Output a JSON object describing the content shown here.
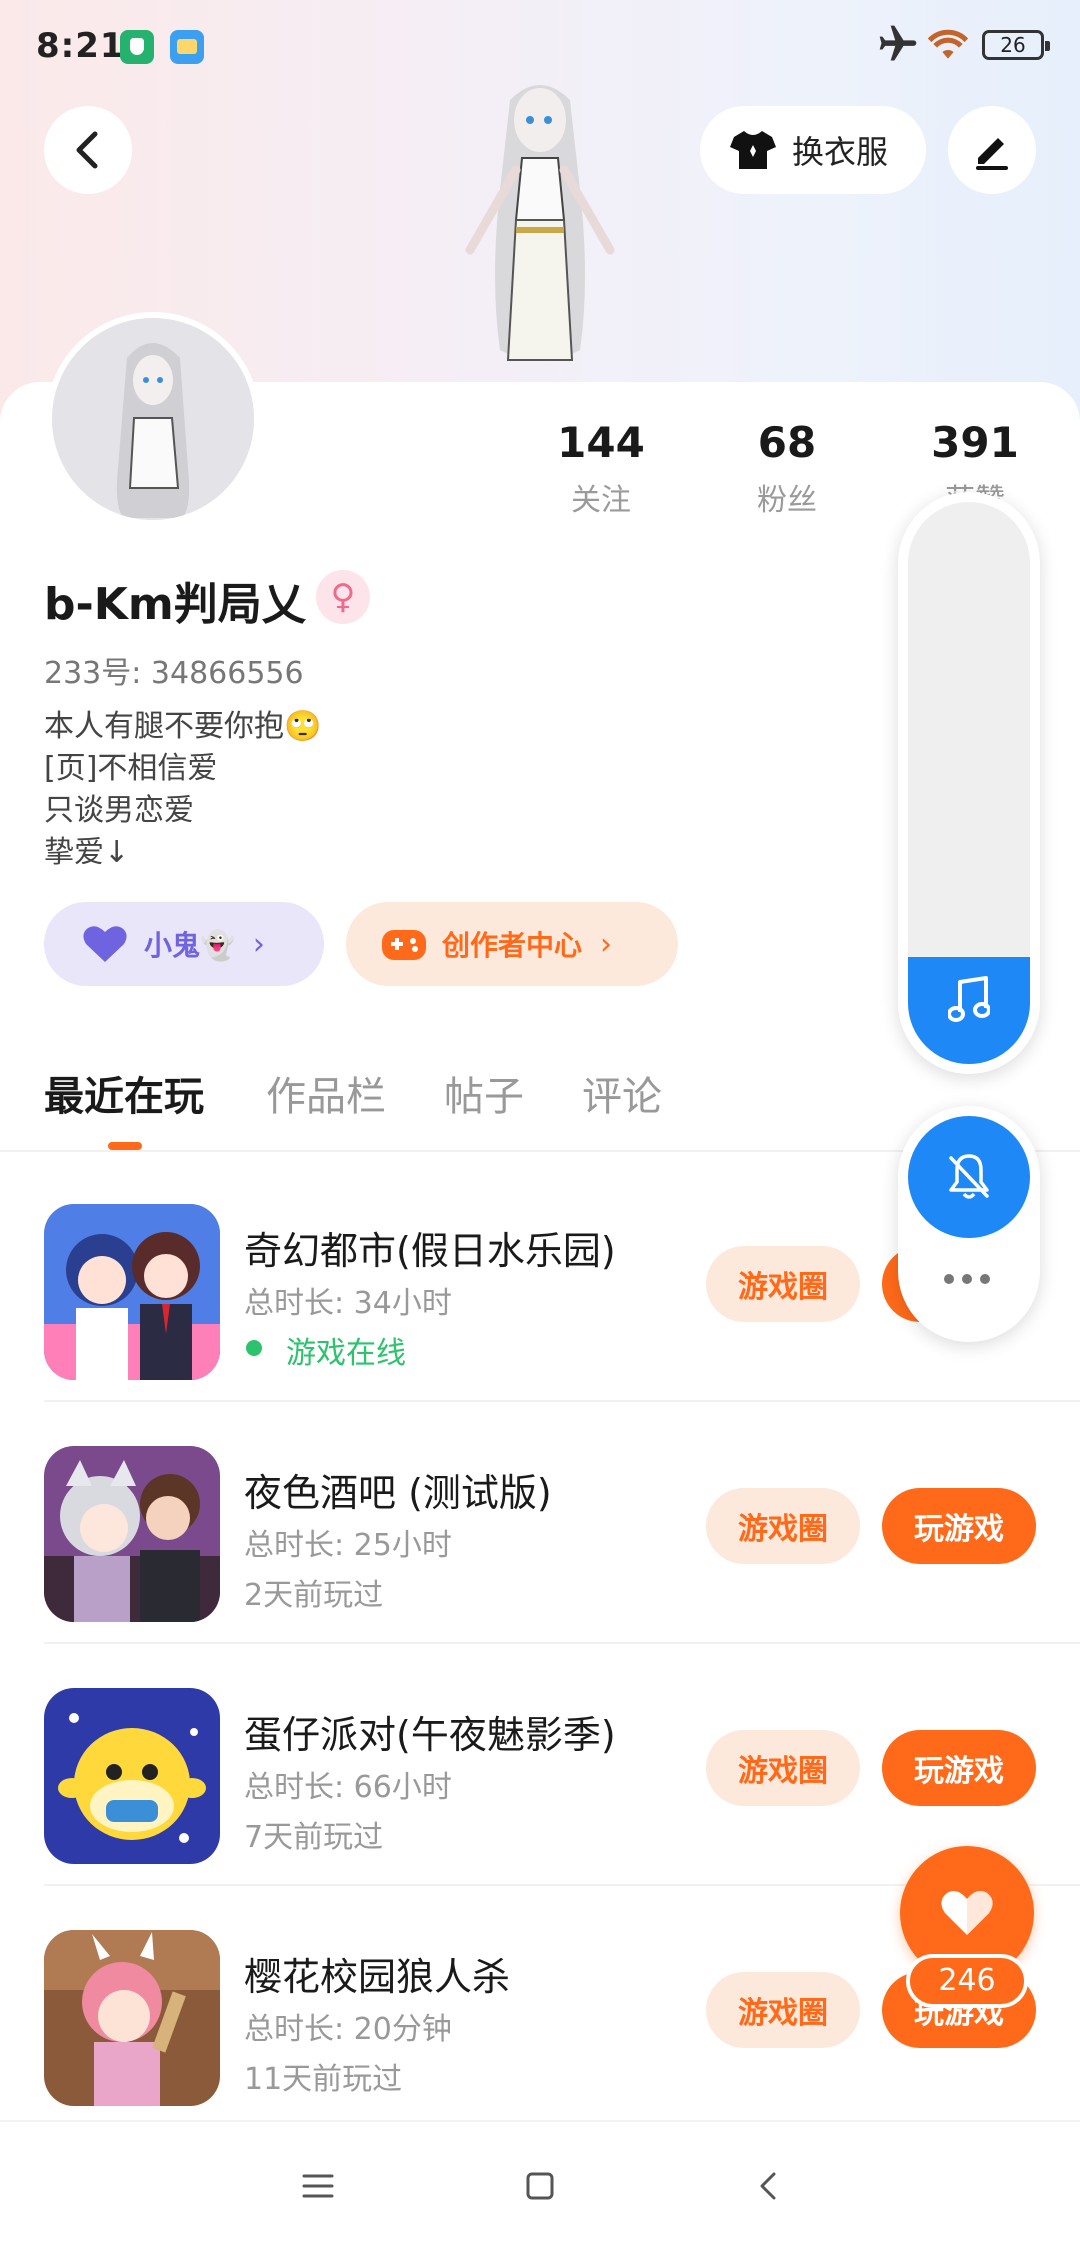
{
  "status_bar": {
    "time": "8:21",
    "battery": "26"
  },
  "header": {
    "outfit_label": "换衣服"
  },
  "stats": [
    {
      "num": "144",
      "label": "关注"
    },
    {
      "num": "68",
      "label": "粉丝"
    },
    {
      "num": "391",
      "label": "获赞"
    }
  ],
  "profile": {
    "username": "b-Km判局乂",
    "gender_symbol": "♀",
    "uid": "233号: 34866556",
    "bio": [
      "本人有腿不要你抱🙄",
      "[页]不相信爱",
      "只谈男恋爱",
      "挚爱↓"
    ]
  },
  "pills": {
    "friend": "小鬼👻",
    "creator": "创作者中心"
  },
  "tabs": [
    "最近在玩",
    "作品栏",
    "帖子",
    "评论"
  ],
  "games": [
    {
      "name": "奇幻都市(假日水乐园)",
      "time": "总时长: 34小时",
      "status": "游戏在线",
      "online": true,
      "circle": "游戏圈",
      "play": "玩游戏"
    },
    {
      "name": "夜色酒吧 (测试版)",
      "time": "总时长: 25小时",
      "status": "2天前玩过",
      "online": false,
      "circle": "游戏圈",
      "play": "玩游戏"
    },
    {
      "name": "蛋仔派对(午夜魅影季)",
      "time": "总时长: 66小时",
      "status": "7天前玩过",
      "online": false,
      "circle": "游戏圈",
      "play": "玩游戏"
    },
    {
      "name": "樱花校园狼人杀",
      "time": "总时长: 20分钟",
      "status": "11天前玩过",
      "online": false,
      "circle": "游戏圈",
      "play": "玩游戏"
    }
  ],
  "volume_level": 0.19,
  "like_count": "246",
  "colors": {
    "accent": "#ff6a1a",
    "blue": "#1e88f6",
    "online": "#2cc36e"
  }
}
